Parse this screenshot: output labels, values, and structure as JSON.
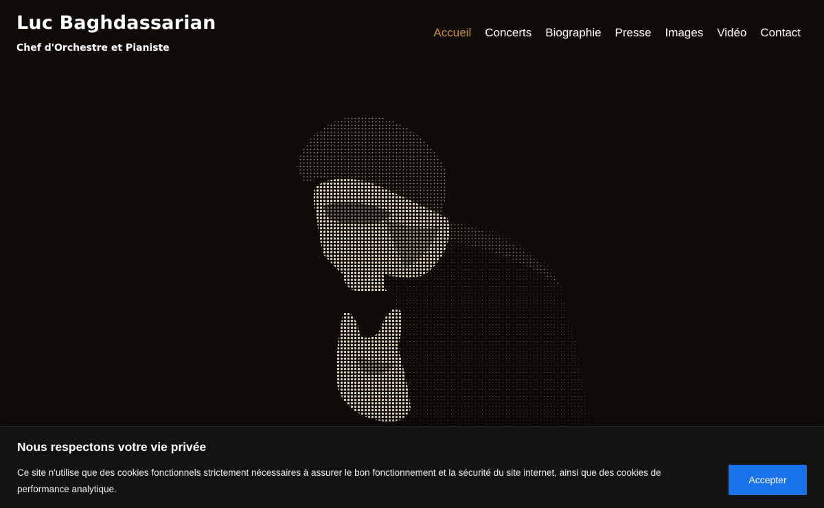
{
  "header": {
    "title": "Luc Baghdassarian",
    "subtitle": "Chef d'Orchestre et Pianiste"
  },
  "nav": {
    "items": [
      {
        "label": "Accueil",
        "active": true
      },
      {
        "label": "Concerts",
        "active": false
      },
      {
        "label": "Biographie",
        "active": false
      },
      {
        "label": "Presse",
        "active": false
      },
      {
        "label": "Images",
        "active": false
      },
      {
        "label": "Vidéo",
        "active": false
      },
      {
        "label": "Contact",
        "active": false
      }
    ],
    "active_color": "#c98f3d"
  },
  "hero": {
    "image_subject": "halftone portrait of a conductor gesturing with raised hand",
    "background_color": "#0f0b09",
    "tint_color": "#e8dcc4"
  },
  "cookie_banner": {
    "title": "Nous respectons votre vie privée",
    "text": "Ce site n'utilise que des cookies fonctionnels strictement nécessaires à assurer le bon fonctionnement et la sécurité du site internet, ainsi que des cookies de performance analytique.",
    "accept_label": "Accepter",
    "button_color": "#1a73e8"
  }
}
